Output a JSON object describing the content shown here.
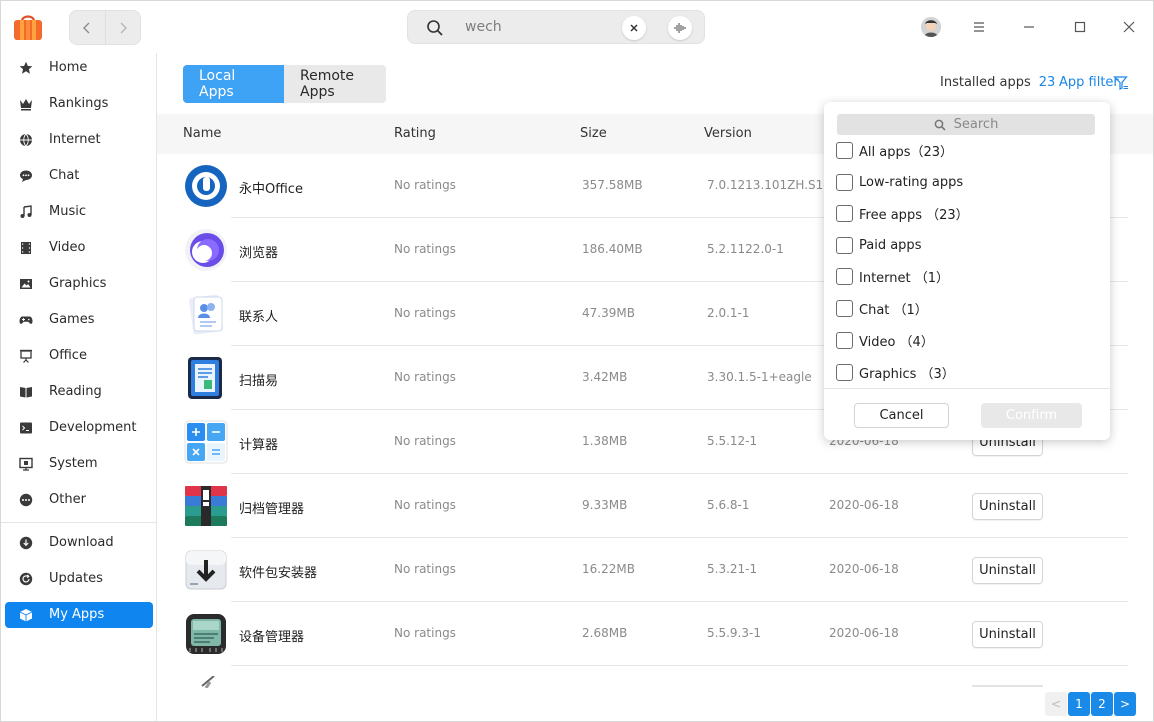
{
  "search": {
    "query": "wech"
  },
  "sidebar": {
    "items": [
      {
        "label": "Home",
        "icon": "star-icon"
      },
      {
        "label": "Rankings",
        "icon": "crown-icon"
      },
      {
        "label": "Internet",
        "icon": "globe-icon"
      },
      {
        "label": "Chat",
        "icon": "chat-bubble-icon"
      },
      {
        "label": "Music",
        "icon": "music-note-icon"
      },
      {
        "label": "Video",
        "icon": "film-icon"
      },
      {
        "label": "Graphics",
        "icon": "image-icon"
      },
      {
        "label": "Games",
        "icon": "gamepad-icon"
      },
      {
        "label": "Office",
        "icon": "presentation-icon"
      },
      {
        "label": "Reading",
        "icon": "book-icon"
      },
      {
        "label": "Development",
        "icon": "terminal-icon"
      },
      {
        "label": "System",
        "icon": "monitor-icon"
      },
      {
        "label": "Other",
        "icon": "more-dots-icon"
      }
    ],
    "bottom_items": [
      {
        "label": "Download",
        "icon": "download-icon"
      },
      {
        "label": "Updates",
        "icon": "refresh-icon"
      },
      {
        "label": "My Apps",
        "icon": "box-icon"
      }
    ]
  },
  "tabs": {
    "local": "Local Apps",
    "remote": "Remote Apps"
  },
  "installed": {
    "label": "Installed apps",
    "count": "23"
  },
  "filter": {
    "label": "App filter"
  },
  "table": {
    "headers": {
      "name": "Name",
      "rating": "Rating",
      "size": "Size",
      "version": "Version"
    },
    "rows": [
      {
        "name": "永中Office",
        "rating": "No ratings",
        "size": "357.58MB",
        "version": "7.0.1213.101ZH.S1-1",
        "date": "",
        "action": ""
      },
      {
        "name": "浏览器",
        "rating": "No ratings",
        "size": "186.40MB",
        "version": "5.2.1122.0-1",
        "date": "",
        "action": ""
      },
      {
        "name": "联系人",
        "rating": "No ratings",
        "size": "47.39MB",
        "version": "2.0.1-1",
        "date": "",
        "action": ""
      },
      {
        "name": "扫描易",
        "rating": "No ratings",
        "size": "3.42MB",
        "version": "3.30.1.5-1+eagle",
        "date": "",
        "action": ""
      },
      {
        "name": "计算器",
        "rating": "No ratings",
        "size": "1.38MB",
        "version": "5.5.12-1",
        "date": "2020-06-18",
        "action": "Uninstall"
      },
      {
        "name": "归档管理器",
        "rating": "No ratings",
        "size": "9.33MB",
        "version": "5.6.8-1",
        "date": "2020-06-18",
        "action": "Uninstall"
      },
      {
        "name": "软件包安装器",
        "rating": "No ratings",
        "size": "16.22MB",
        "version": "5.3.21-1",
        "date": "2020-06-18",
        "action": "Uninstall"
      },
      {
        "name": "设备管理器",
        "rating": "No ratings",
        "size": "2.68MB",
        "version": "5.5.9.3-1",
        "date": "2020-06-18",
        "action": "Uninstall"
      }
    ]
  },
  "pagination": {
    "pages": [
      "1",
      "2"
    ],
    "current": "1",
    "prev": "<",
    "next": ">"
  },
  "popup": {
    "search_placeholder": "Search",
    "options": [
      "All apps（23）",
      "Low-rating apps",
      "Free apps （23）",
      "Paid apps",
      "Internet （1）",
      "Chat （1）",
      "Video （4）",
      "Graphics （3）"
    ],
    "cancel": "Cancel",
    "confirm": "Confirm"
  },
  "colors": {
    "accent": "#0f86ef",
    "tab_active": "#3ea2f5",
    "link": "#1a86e8"
  }
}
